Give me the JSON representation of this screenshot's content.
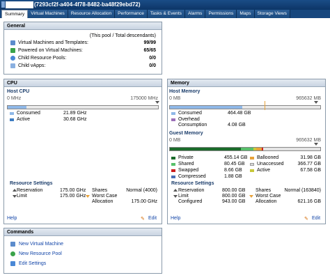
{
  "window": {
    "title": "(7293cf2f-a404-4f78-8482-ba48f29ebd72)"
  },
  "tabs": [
    "Summary",
    "Virtual Machines",
    "Resource Allocation",
    "Performance",
    "Tasks & Events",
    "Alarms",
    "Permissions",
    "Maps",
    "Storage Views"
  ],
  "general": {
    "title": "General",
    "header_note": "(This pool / Total descendants)",
    "rows": [
      {
        "label": "Virtual Machines and Templates:",
        "value": "99/99"
      },
      {
        "label": "Powered on Virtual Machines:",
        "value": "65/65"
      },
      {
        "label": "Child Resource Pools:",
        "value": "0/0"
      },
      {
        "label": "Child vApps:",
        "value": "0/0"
      }
    ]
  },
  "cpu": {
    "title": "CPU",
    "section": "Host CPU",
    "min": "0 MHz",
    "max": "175000 MHz",
    "consumed_fraction": 0.125,
    "active_fraction": 0.175,
    "legend": [
      {
        "label": "Consumed",
        "value": "21.89 GHz",
        "color": "#8fb8e8"
      },
      {
        "label": "Active",
        "value": "30.68 GHz",
        "color": "#3d7cc2"
      }
    ],
    "settings_title": "Resource Settings",
    "reservation_label": "Reservation",
    "reservation": "175.00 GHz",
    "limit_label": "Limit",
    "limit": "175.00 GHz",
    "shares_label": "Shares",
    "shares": "Normal (4000)",
    "worst_case_label": "Worst Case",
    "allocation_label": "Allocation",
    "worst_case": "175.00 GHz",
    "help": "Help",
    "edit": "Edit"
  },
  "memory": {
    "title": "Memory",
    "section": "Host Memory",
    "min": "0 MB",
    "max": "965632 MB",
    "consumed_fraction": 0.48,
    "limit_fraction": 0.629,
    "legend": [
      {
        "label": "Consumed",
        "value": "464.48 GB",
        "color": "#8fb8e8"
      },
      {
        "label": "Overhead",
        "value": "",
        "color": "#9b6fb8"
      },
      {
        "label": "Consumption",
        "value": "4.08 GB",
        "color": ""
      }
    ],
    "guest_title": "Guest Memory",
    "gmin": "0 MB",
    "gmax": "965632 MB",
    "guest_left": [
      {
        "label": "Private",
        "value": "455.14 GB",
        "color": "#1b6b2a"
      },
      {
        "label": "Shared",
        "value": "80.45 GB",
        "color": "#58c06b"
      },
      {
        "label": "Swapped",
        "value": "8.66 GB",
        "color": "#cc1f1f"
      },
      {
        "label": "Compressed",
        "value": "1.88 GB",
        "color": "#4a6fb5"
      }
    ],
    "guest_right": [
      {
        "label": "Ballooned",
        "value": "31.98 GB",
        "color": "#e8a23a"
      },
      {
        "label": "Unaccessed",
        "value": "366.77 GB",
        "color": "#d8d8d8"
      },
      {
        "label": "Active",
        "value": "67.58 GB",
        "color": "#c8c83a"
      }
    ],
    "settings_title": "Resource Settings",
    "reservation_label": "Reservation",
    "reservation": "800.00 GB",
    "limit_label": "Limit",
    "limit": "800.00 GB",
    "configured_label": "Configured",
    "configured": "943.00 GB",
    "shares_label": "Shares",
    "shares": "Normal (163840)",
    "worst_case_label": "Worst Case",
    "allocation_label": "Allocation",
    "worst_case": "621.16 GB",
    "help": "Help",
    "edit": "Edit"
  },
  "commands": {
    "title": "Commands",
    "items": [
      "New Virtual Machine",
      "New Resource Pool",
      "Edit Settings"
    ]
  }
}
